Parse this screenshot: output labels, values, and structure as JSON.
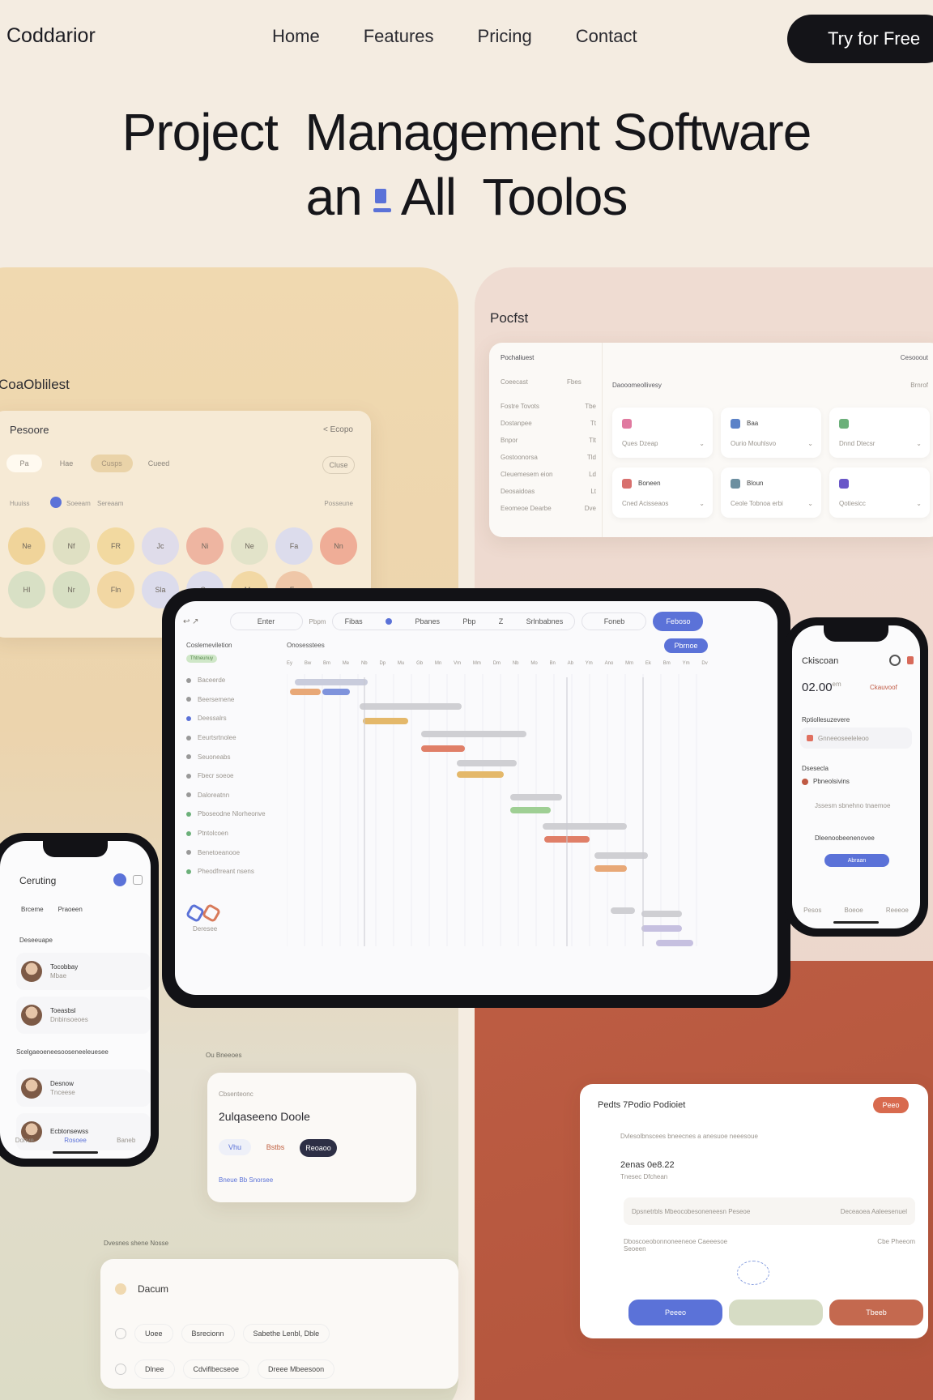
{
  "nav": {
    "logo": "Coddarior",
    "links": [
      "Home",
      "Features",
      "Pricing",
      "Contact"
    ],
    "cta": "Try for Free"
  },
  "hero": {
    "line1": "Project  Management Software",
    "line2_a": "an",
    "line2_b": "All  Toolos"
  },
  "left_panel": {
    "label": "CoaOblilest",
    "card_title": "Pesoore",
    "card_action": "< Ecopo",
    "chips": [
      "Pa",
      "Hae",
      "Cusps",
      "Cueed"
    ],
    "chip_right": "Cluse",
    "row_label_a": "Huuiss",
    "row_label_b": "Soeeam",
    "row_label_c": "Sereaam",
    "row_label_right": "Posseune",
    "circle_colors": [
      "#f0d49a",
      "#dfe0c3",
      "#f2d9a0",
      "#dfdcea",
      "#eeb5a1",
      "#e2e3c9",
      "#dcdcec",
      "#efad97",
      "#d8e0c5",
      "#d7dfc3",
      "#f2d7a3",
      "#dcdcec",
      "#dcdcec",
      "#f2d8a4",
      "#efc7a8"
    ],
    "circle_labels": [
      "Ne",
      "Nf",
      "FR",
      "Jc",
      "Ni",
      "Ne",
      "Fa",
      "Nn",
      "HI",
      "Nr",
      "Fln",
      "Sla",
      "Ca",
      "Mn",
      "Fp"
    ]
  },
  "right_panel": {
    "label": "Pocfst",
    "card_header_left": "Pochaliuest",
    "card_header_right": "Cesooout",
    "sub_left": "Coeecast",
    "sub_right": "Fbes",
    "sub_center": "Daooomeollivesy",
    "sub_center_right": "Brnrof",
    "list": [
      [
        "Fostre Tovots",
        "Tbe"
      ],
      [
        "Dostanpee",
        "Tt"
      ],
      [
        "Bnpor",
        "Tlt"
      ],
      [
        "Gostoonorsa",
        "Tld"
      ],
      [
        "Cleuemesem eion",
        "Ld"
      ],
      [
        "Deosaidoas",
        "Lt"
      ],
      [
        "Eeomeoe Dearbe",
        "Dve"
      ]
    ],
    "tiles": [
      {
        "icon_color": "#e07aa0",
        "title": "",
        "sub": "Ques Dzeap"
      },
      {
        "icon_color": "#5b82c8",
        "title": "Baa",
        "sub": "Ourio Mouhlsvo"
      },
      {
        "icon_color": "#6cb07a",
        "title": "",
        "sub": "Dnnd Dtecsr"
      },
      {
        "icon_color": "#d8706e",
        "title": "Boneen",
        "sub": "Cned Acisseaos"
      },
      {
        "icon_color": "#6c8fa0",
        "title": "Bloun",
        "sub": "Ceole Tobnoa erbi"
      },
      {
        "icon_color": "#6a57c8",
        "title": "",
        "sub": "Qotiesicc"
      }
    ]
  },
  "tablet": {
    "toolbar": [
      "Enter",
      "Pbpm",
      "Fibas",
      "Pbanes",
      "Pbp",
      "Z",
      "Srlnbabnes",
      "Foneb",
      "Feboso"
    ],
    "sidebar_title": "Coslemeviletion",
    "sidebar_badge": "Thtneunuy",
    "sidebar_items": [
      "Baceerde",
      "Beersemene",
      "Deessalrs",
      "Eeurtsrtnolee",
      "Seuoneabs",
      "Fbecr soeoe",
      "Daloreatnn",
      "Pboseodne Nlorheonve",
      "Ptntolcoen",
      "Benetoeanooe",
      "Pheodfrreant nsens"
    ],
    "main_title": "Onosesstees",
    "main_btn": "Pbrnoe",
    "footer_label": "Deresee",
    "timeline_cols": [
      "Ey",
      "Bw",
      "Bm",
      "Me",
      "Nb",
      "Dp",
      "Mu",
      "Gb",
      "Mn",
      "Vm",
      "Mm",
      "Dm",
      "Nb",
      "Mo",
      "Bn",
      "Ab",
      "Ym",
      "Ano",
      "Mm",
      "Ek",
      "Bm",
      "Ym",
      "Dv"
    ]
  },
  "phone_right": {
    "title": "Ckiscoan",
    "time": "02.00",
    "time_suffix": "em",
    "badge": "Ckauvoof",
    "section_a": "Rptiollesuzevere",
    "row_a": "Gnneeoseeleleoo",
    "section_b": "Dsesecla",
    "row_b": "Pbneolsivins",
    "row_b_sub": "Jssesm sbnehno tnaemoe",
    "row_c": "Dleenoobeenenovee",
    "btn": "Abraan",
    "tabs": [
      "Pesos",
      "Boeoe",
      "Reeeoe"
    ]
  },
  "phone_left": {
    "title": "Ceruting",
    "row_top_a": "Brceme",
    "row_top_b": "Praoeen",
    "section_a": "Deseeuape",
    "people": [
      {
        "name": "Tocobbay",
        "sub": "Mbae"
      },
      {
        "name": "Toeasbsl",
        "sub": "Dnbinsoeoes"
      },
      {
        "name": "Desnow",
        "sub": "Tnceese"
      },
      {
        "name": "Ecbtonsewss",
        "sub": ""
      }
    ],
    "section_b": "Scelgaeoeneesooseneeleuesee",
    "tabs": [
      "Donve",
      "Rosoee",
      "Baneb"
    ]
  },
  "mid_card": {
    "label": "Ou Bneeoes",
    "title_small": "Cbsenteonc",
    "title": "2ulqaseeno Doole",
    "buttons": [
      "Vhu",
      "Bstbs",
      "Reoaoo"
    ],
    "footer": "Bneue Bb Snorsee"
  },
  "bottom_card": {
    "label": "Dvesnes shene Nosse",
    "title": "Dacum",
    "rows": [
      [
        "Uoee",
        "Bsrecionn",
        "Sabethe Lenbl, Dble"
      ],
      [
        "Dlnee",
        "Cdviflbecseoe",
        "Dreee Mbeesoon"
      ]
    ]
  },
  "rust_card": {
    "title": "Pedts 7Podio Podioiet",
    "badge": "Peeo",
    "line1": "Dvlesolbnscees bneecnes a anesuoe neeesoue",
    "code": "2enas 0e8.22",
    "code_sub": "Tnesec Dfchean",
    "row_a_left": "Dpsnetrbls Mbeocobesoneneesn Peseoe",
    "row_a_right": "Deceaoea Aaleesenuel",
    "row_b_left": "Dboscoeobonnoneeneoe Caeeesoe Seoeen",
    "row_b_right": "Cbe Pheeom",
    "buttons": [
      "Peeeo",
      "",
      "Tbeeb"
    ]
  },
  "colors": {
    "blue": "#5b72d8",
    "rust": "#c4694f",
    "sage": "#d6dcc4",
    "dark": "#141418"
  }
}
